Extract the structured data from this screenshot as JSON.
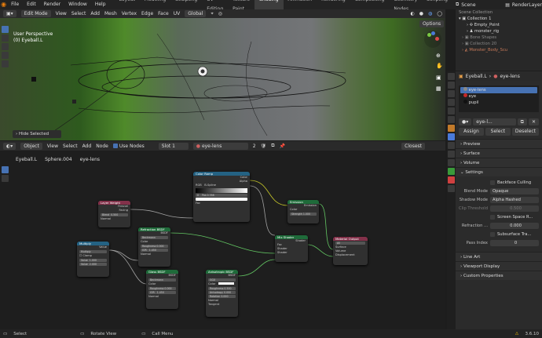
{
  "app": {
    "menu": [
      "File",
      "Edit",
      "Render",
      "Window",
      "Help"
    ],
    "workspaces": [
      "Layout",
      "Modeling",
      "Sculpting",
      "UV Editing",
      "Texture Paint",
      "Shading",
      "Animation",
      "Rendering",
      "Compositing",
      "Geometry Nodes",
      "Scripting"
    ],
    "scene": "Scene",
    "render_layer": "RenderLayer"
  },
  "viewport": {
    "mode": "Edit Mode",
    "menus": [
      "View",
      "Select",
      "Add",
      "Mesh",
      "Vertex",
      "Edge",
      "Face",
      "UV"
    ],
    "orientation": "Global",
    "options": "Options",
    "perspective": "User Perspective",
    "object": "(0) Eyeball.L",
    "hide_selected": "Hide Selected"
  },
  "node_editor": {
    "type": "Object",
    "menus": [
      "View",
      "Select",
      "Add",
      "Node"
    ],
    "use_nodes": "Use Nodes",
    "slot": "Slot 1",
    "material": "eye-lens",
    "users": "2",
    "interp": "Closest",
    "breadcrumb": [
      "Eyeball.L",
      "Sphere.004",
      "eye-lens"
    ]
  },
  "nodes": {
    "colorramp": {
      "title": "Color Ramp",
      "out1": "Color",
      "out2": "Alpha",
      "mode": "RGB",
      "interp": "B-Spline",
      "stop": "0",
      "pos": "Pos",
      "posv": "0.358",
      "fac": "Fac"
    },
    "layerweight": {
      "title": "Layer Weight",
      "out1": "Fresnel",
      "out2": "Facing",
      "blend": "Blend",
      "blendv": "0.500",
      "normal": "Normal"
    },
    "emission": {
      "title": "Emission",
      "out": "Emission",
      "color": "Color",
      "strength": "Strength",
      "strengthv": "1.000"
    },
    "refraction": {
      "title": "Refraction BSDF",
      "out": "BSDF",
      "dist": "Beckmann",
      "color": "Color",
      "rough": "Roughness",
      "roughv": "0.000",
      "ior": "IOR",
      "iorv": "1.450",
      "normal": "Normal"
    },
    "multiply": {
      "title": "Multiply",
      "out": "Value",
      "op": "Multiply",
      "clamp": "Clamp",
      "v1": "Value",
      "v1v": "1.000",
      "v2": "Value",
      "v2v": "2.000"
    },
    "glass": {
      "title": "Glass BSDF",
      "out": "BSDF",
      "dist": "Beckmann",
      "color": "Color",
      "rough": "Roughness",
      "roughv": "0.000",
      "ior": "IOR",
      "iorv": "1.450",
      "normal": "Normal"
    },
    "mix": {
      "title": "Mix Shader",
      "out": "Shader",
      "fac": "Fac",
      "s1": "Shader",
      "s2": "Shader"
    },
    "matout": {
      "title": "Material Output",
      "target": "All",
      "surface": "Surface",
      "volume": "Volume",
      "disp": "Displacement"
    },
    "aniso": {
      "title": "Anisotropic BSDF",
      "out": "BSDF",
      "dist": "GGX",
      "color": "Color",
      "rough": "Roughness",
      "roughv": "0.500",
      "anis": "Anisotropy",
      "anisv": "0.000",
      "rot": "Rotation",
      "rotv": "0.000",
      "normal": "Normal",
      "tangent": "Tangent"
    }
  },
  "outliner": {
    "items": [
      "Scene Collection",
      "Collection 1",
      "Empty_Point",
      "monster_rig",
      "Bone Shapes",
      "Collection 20",
      "Monster_Body_Scu"
    ]
  },
  "properties": {
    "object": "Eyeball.L",
    "material": "eye-lens",
    "slots": [
      "eye-lens",
      "eye",
      "pupil"
    ],
    "slot_colors": [
      "#8a8a8a",
      "#c62828",
      "#111111"
    ],
    "mat_name": "eye-l...",
    "assign": "Assign",
    "select": "Select",
    "deselect": "Deselect",
    "panels_top": [
      "Preview",
      "Surface",
      "Volume",
      "Settings"
    ],
    "backface": "Backface Culling",
    "blend_mode_l": "Blend Mode",
    "blend_mode": "Opaque",
    "shadow_mode_l": "Shadow Mode",
    "shadow_mode": "Alpha Hashed",
    "clip_l": "Clip Threshold",
    "clip": "0.500",
    "ssr": "Screen Space R...",
    "refr_l": "Refraction ...",
    "refr": "0.000",
    "sst": "Subsurface Tra...",
    "pass_l": "Pass Index",
    "pass": "0",
    "panels_bottom": [
      "Line Art",
      "Viewport Display",
      "Custom Properties"
    ]
  },
  "status": {
    "select": "Select",
    "rotate": "Rotate View",
    "menu": "Call Menu",
    "version": "3.6.10"
  }
}
